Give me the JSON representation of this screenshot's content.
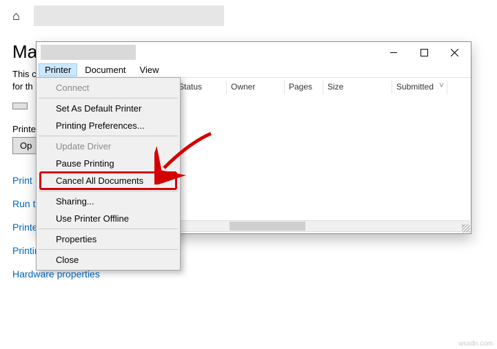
{
  "bg": {
    "heading_partial": "Ma",
    "desc_partial_l1": "This c",
    "desc_partial_l2": "for th",
    "btnPartial": "",
    "printersLbl": "Printers",
    "openBtn": "Op",
    "links": {
      "print": "Print",
      "run": "Run t",
      "printerProps": "Printer properties",
      "prefs": "Printing preferences",
      "hardware": "Hardware properties"
    }
  },
  "pwin": {
    "menubar": {
      "printer": "Printer",
      "document": "Document",
      "view": "View"
    },
    "columns": {
      "status": "Status",
      "owner": "Owner",
      "pages": "Pages",
      "size": "Size",
      "submitted": "Submitted"
    }
  },
  "menu": {
    "connect": "Connect",
    "setDefault": "Set As Default Printer",
    "prefs": "Printing Preferences...",
    "update": "Update Driver",
    "pause": "Pause Printing",
    "cancelAll": "Cancel All Documents",
    "sharing": "Sharing...",
    "offline": "Use Printer Offline",
    "props": "Properties",
    "close": "Close"
  },
  "watermark": "wsxdn.com"
}
